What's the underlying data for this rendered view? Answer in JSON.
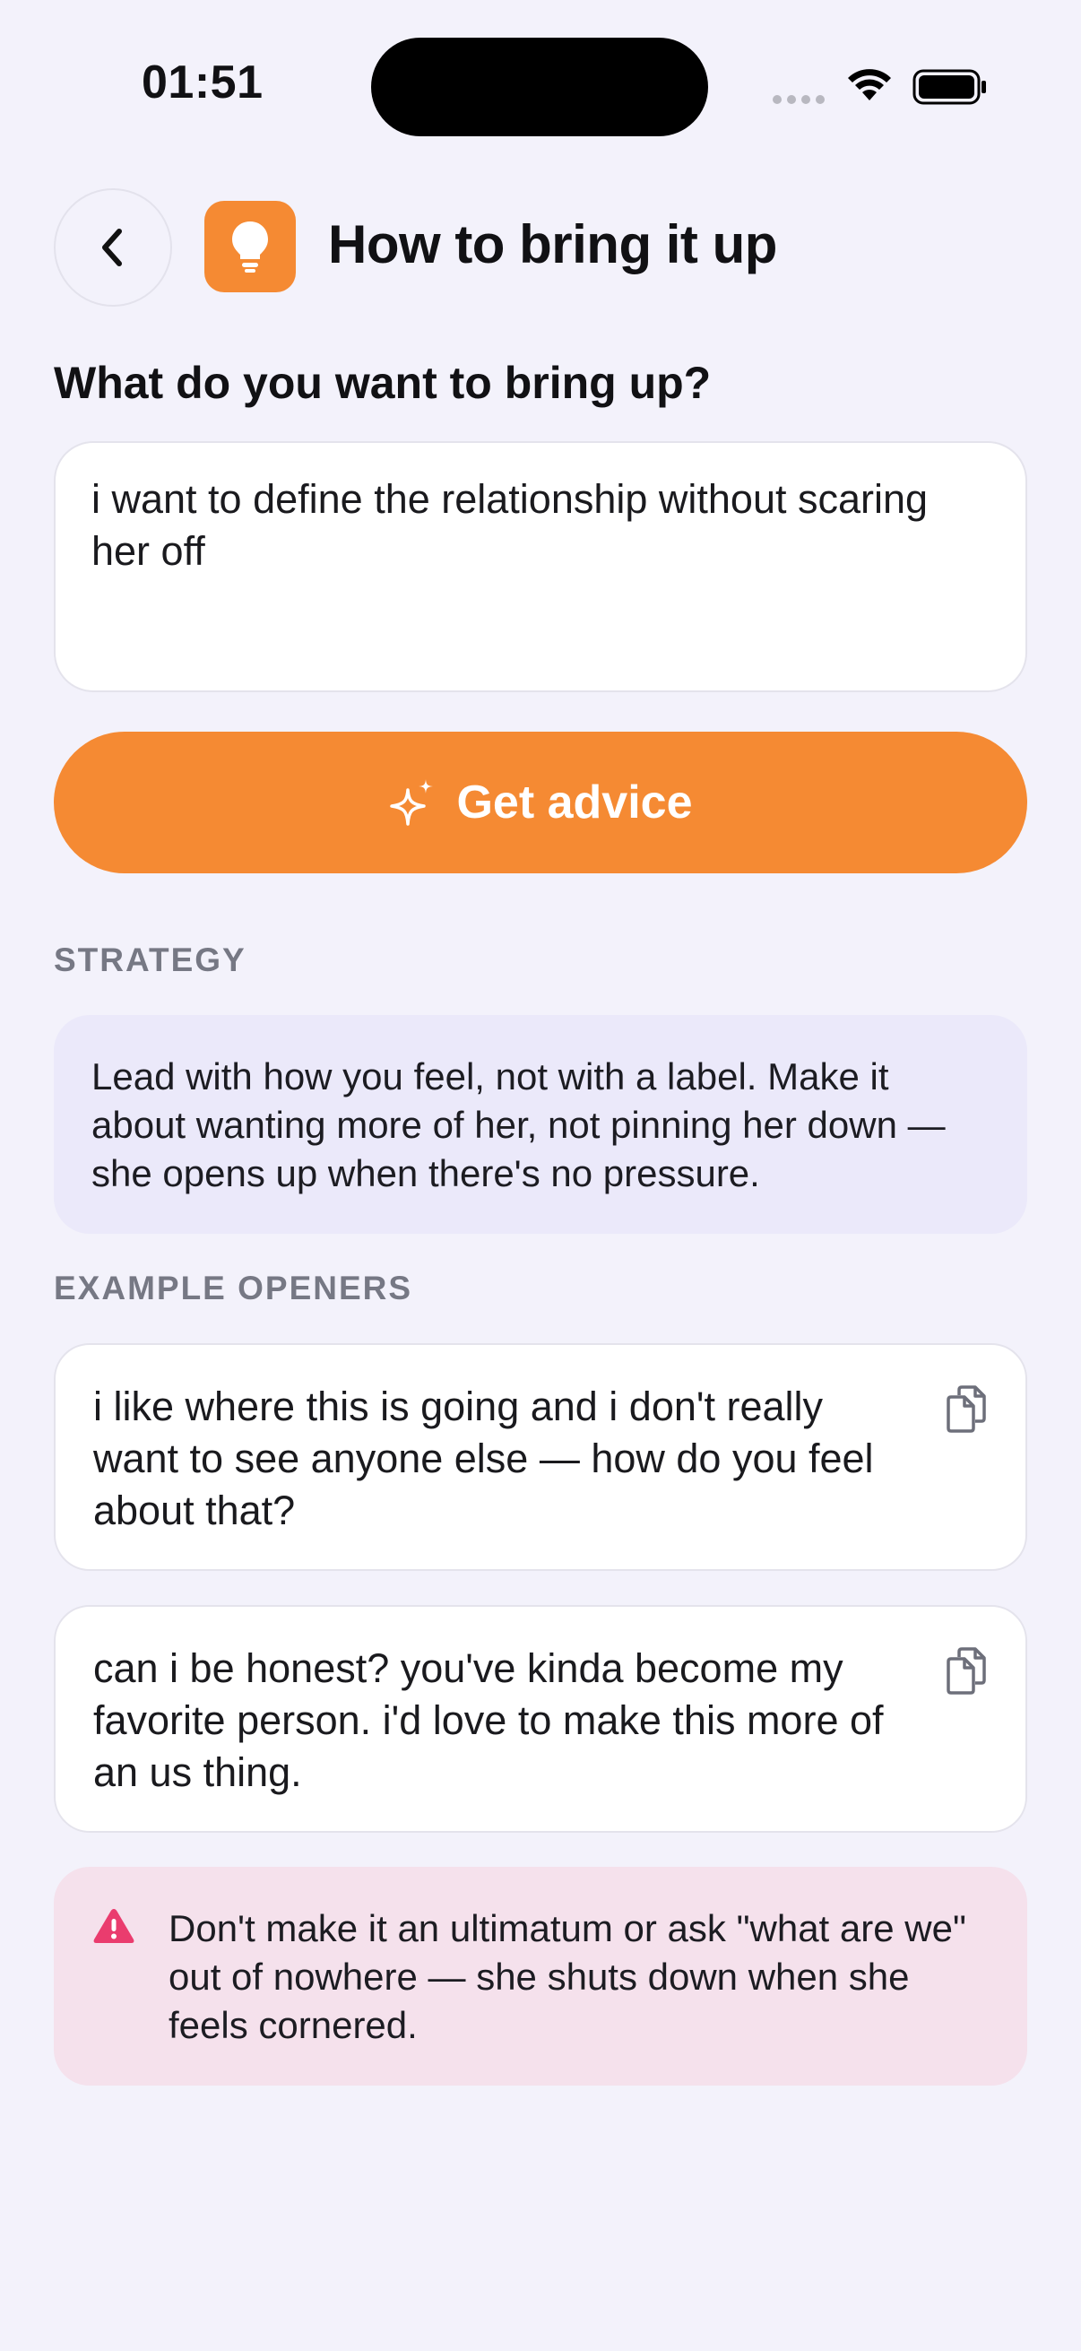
{
  "status_bar": {
    "time": "01:51"
  },
  "header": {
    "title": "How to bring it up",
    "back_icon": "chevron-left-icon",
    "app_icon": "lightbulb-icon"
  },
  "prompt": {
    "label": "What do you want to bring up?",
    "value": "i want to define the relationship without scaring her off"
  },
  "advice_button": {
    "label": "Get advice",
    "icon": "sparkles-icon"
  },
  "strategy": {
    "heading": "STRATEGY",
    "text": "Lead with how you feel, not with a label. Make it about wanting more of her, not pinning her down — she opens up when there's no pressure."
  },
  "openers": {
    "heading": "EXAMPLE OPENERS",
    "items": [
      {
        "text": "i like where this is going and i don't really want to see anyone else — how do you feel about that?"
      },
      {
        "text": "can i be honest? you've kinda become my favorite person. i'd love to make this more of an us thing."
      }
    ]
  },
  "warning": {
    "text": "Don't make it an ultimatum or ask \"what are we\" out of nowhere — she shuts down when she feels cornered."
  },
  "colors": {
    "accent": "#f58a33",
    "background": "#f3f2fb",
    "strategy_bg": "#ebe9fa",
    "warning_bg": "#f5e1ec",
    "warning_icon": "#ea3c6e"
  }
}
